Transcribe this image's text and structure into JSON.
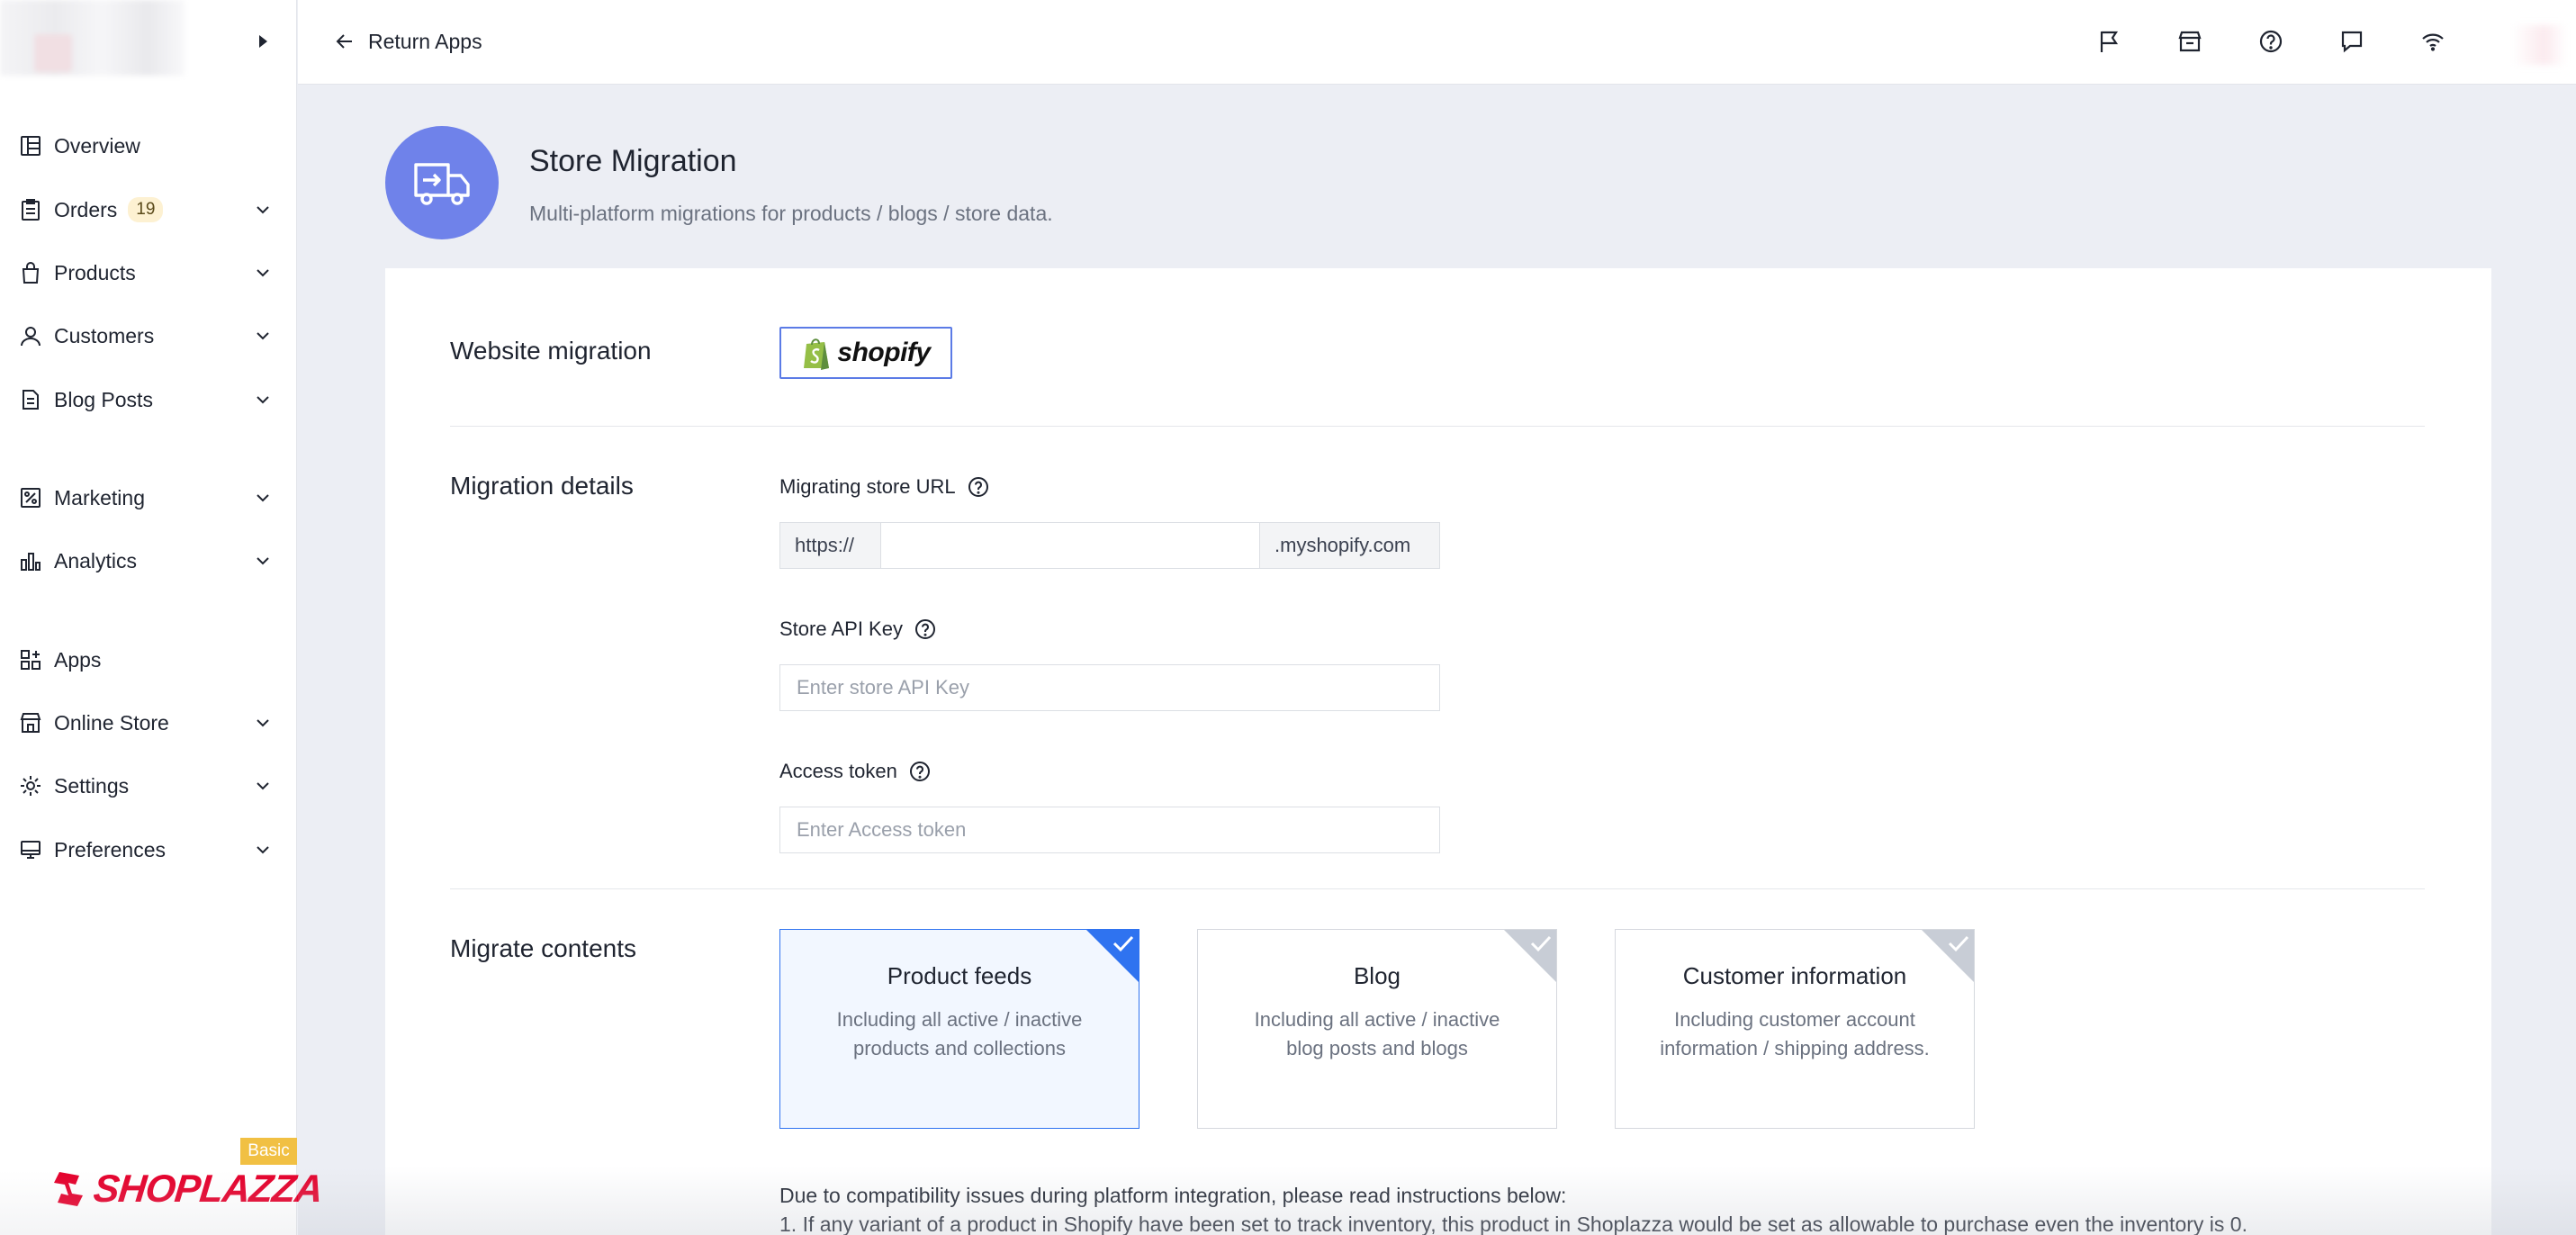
{
  "sidebar": {
    "items": [
      {
        "label": "Overview",
        "icon": "overview-icon"
      },
      {
        "label": "Orders",
        "icon": "orders-icon",
        "badge": "19"
      },
      {
        "label": "Products",
        "icon": "products-icon"
      },
      {
        "label": "Customers",
        "icon": "customers-icon"
      },
      {
        "label": "Blog Posts",
        "icon": "blog-posts-icon"
      },
      {
        "label": "Marketing",
        "icon": "marketing-icon"
      },
      {
        "label": "Analytics",
        "icon": "analytics-icon"
      },
      {
        "label": "Apps",
        "icon": "apps-icon"
      },
      {
        "label": "Online Store",
        "icon": "online-store-icon"
      },
      {
        "label": "Settings",
        "icon": "settings-icon"
      },
      {
        "label": "Preferences",
        "icon": "preferences-icon"
      }
    ],
    "plan_badge": "Basic",
    "logo_text": "SHOPLAZZA"
  },
  "topbar": {
    "return_label": "Return Apps",
    "icons": [
      "flag-icon",
      "store-icon",
      "help-icon",
      "chat-icon",
      "wifi-icon"
    ]
  },
  "app": {
    "title": "Store Migration",
    "subtitle": "Multi-platform migrations for products / blogs / store data."
  },
  "website_migration": {
    "title": "Website migration",
    "platform_label": "shopify"
  },
  "migration_details": {
    "title": "Migration details",
    "store_url": {
      "label": "Migrating store URL",
      "prefix": "https://",
      "suffix": ".myshopify.com",
      "value": ""
    },
    "api_key": {
      "label": "Store API Key",
      "placeholder": "Enter store API Key",
      "value": ""
    },
    "access_token": {
      "label": "Access token",
      "placeholder": "Enter Access token",
      "value": ""
    }
  },
  "migrate_contents": {
    "title": "Migrate contents",
    "options": [
      {
        "title": "Product feeds",
        "desc": "Including all active / inactive products and collections",
        "selected": true
      },
      {
        "title": "Blog",
        "desc": "Including all active / inactive blog posts and blogs",
        "selected": false
      },
      {
        "title": "Customer information",
        "desc": "Including customer account information / shipping address.",
        "selected": false
      }
    ]
  },
  "notice": {
    "intro": "Due to compatibility issues during platform integration, please read instructions below:",
    "line1": "1. If any variant of a product in Shopify have been set to track inventory, this product in Shoplazza would be set as allowable to purchase even the inventory is 0."
  },
  "colors": {
    "accent": "#2f73f0",
    "app_icon_bg": "#6f82ea",
    "badge_bg": "#f1c043",
    "logo_red": "#e4002b",
    "shopify_green": "#95bf47"
  }
}
